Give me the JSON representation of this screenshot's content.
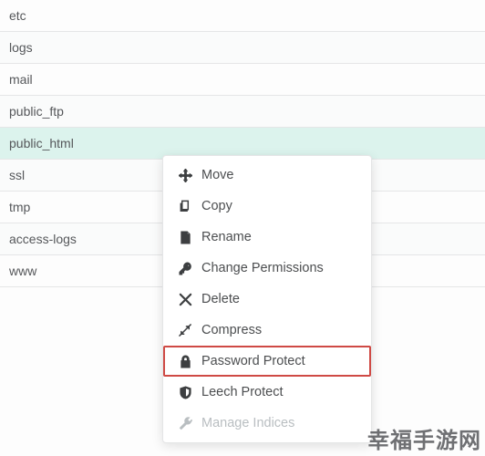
{
  "files": [
    {
      "name": "etc",
      "selected": false
    },
    {
      "name": "logs",
      "selected": false
    },
    {
      "name": "mail",
      "selected": false
    },
    {
      "name": "public_ftp",
      "selected": false
    },
    {
      "name": "public_html",
      "selected": true
    },
    {
      "name": "ssl",
      "selected": false
    },
    {
      "name": "tmp",
      "selected": false
    },
    {
      "name": "access-logs",
      "selected": false
    },
    {
      "name": "www",
      "selected": false
    }
  ],
  "context_menu": {
    "items": [
      {
        "key": "move",
        "label": "Move",
        "icon": "move-icon",
        "highlighted": false,
        "disabled": false
      },
      {
        "key": "copy",
        "label": "Copy",
        "icon": "copy-icon",
        "highlighted": false,
        "disabled": false
      },
      {
        "key": "rename",
        "label": "Rename",
        "icon": "rename-icon",
        "highlighted": false,
        "disabled": false
      },
      {
        "key": "change-permissions",
        "label": "Change Permissions",
        "icon": "key-icon",
        "highlighted": false,
        "disabled": false
      },
      {
        "key": "delete",
        "label": "Delete",
        "icon": "delete-icon",
        "highlighted": false,
        "disabled": false
      },
      {
        "key": "compress",
        "label": "Compress",
        "icon": "compress-icon",
        "highlighted": false,
        "disabled": false
      },
      {
        "key": "password-protect",
        "label": "Password Protect",
        "icon": "lock-icon",
        "highlighted": true,
        "disabled": false
      },
      {
        "key": "leech-protect",
        "label": "Leech Protect",
        "icon": "shield-icon",
        "highlighted": false,
        "disabled": false
      },
      {
        "key": "manage-indices",
        "label": "Manage Indices",
        "icon": "wrench-icon",
        "highlighted": false,
        "disabled": true
      }
    ]
  },
  "watermark": "幸福手游网"
}
